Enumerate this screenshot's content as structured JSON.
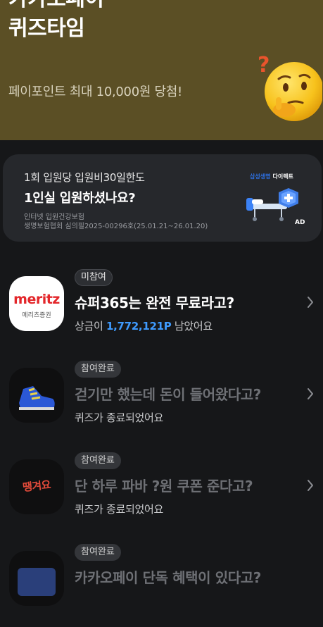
{
  "hero": {
    "title_line1": "카카오페이",
    "title_line2": "퀴즈타임",
    "subtitle": "페이포인트 최대 10,000원 당첨!",
    "emoji": "thinking-face"
  },
  "ad": {
    "line1": "1회 입원당 입원비30일한도",
    "line2": "1인실 입원하셨나요?",
    "note1": "인터넷 입원건강보험",
    "note2": "생명보험협회 심의필2025-00296호(25.01.21~26.01.20)",
    "brand_part1": "삼성생명",
    "brand_part2": "다이렉트",
    "badge": "AD"
  },
  "quizzes": [
    {
      "status": "미참여",
      "title": "슈퍼365는 완전 무료라고?",
      "sub_prefix": "상금이 ",
      "sub_amount": "1,772,121P",
      "sub_suffix": " 남았어요",
      "logo_text": "meritz",
      "logo_subtext": "메리츠증권"
    },
    {
      "status": "참여완료",
      "title": "걷기만 했는데 돈이 들어왔다고?",
      "sub": "퀴즈가 종료되었어요",
      "icon": "sneaker-icon"
    },
    {
      "status": "참여완료",
      "title": "단 하루 파바 ?원 쿠폰 준다고?",
      "sub": "퀴즈가 종료되었어요",
      "logo_text": "땡겨요"
    },
    {
      "status": "참여완료",
      "title": "카카오페이 단독 혜택이 있다고?"
    }
  ],
  "colors": {
    "hero_bg": "#5b4f25",
    "page_bg": "#161719",
    "accent_blue": "#3f9bff",
    "meritz_red": "#e3262a"
  }
}
